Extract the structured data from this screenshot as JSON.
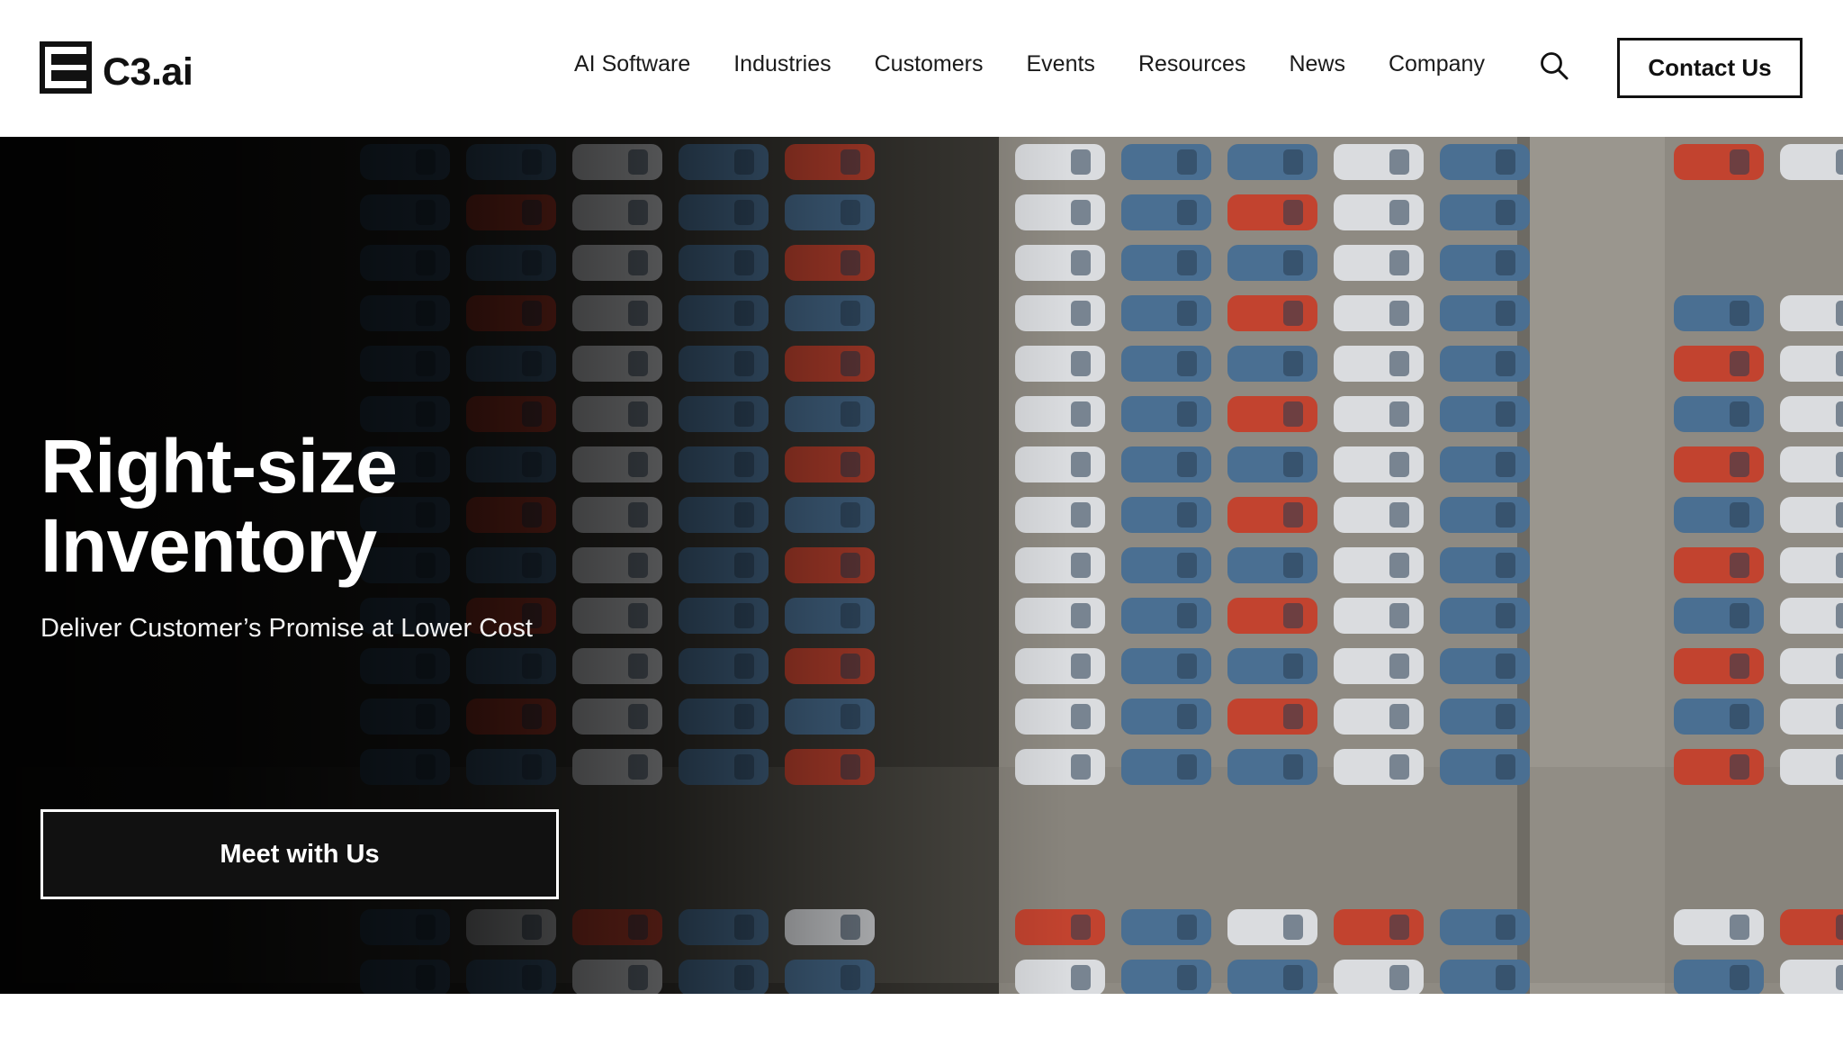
{
  "brand": {
    "logo_text": "C3.ai"
  },
  "nav": {
    "items": [
      {
        "label": "AI Software"
      },
      {
        "label": "Industries"
      },
      {
        "label": "Customers"
      },
      {
        "label": "Events"
      },
      {
        "label": "Resources"
      },
      {
        "label": "News"
      },
      {
        "label": "Company"
      }
    ],
    "search_icon": "search-icon",
    "contact_label": "Contact Us"
  },
  "hero": {
    "title_line1": "Right-size",
    "title_line2": "Inventory",
    "subtitle": "Deliver Customer’s Promise at Lower Cost",
    "cta_label": "Meet with Us",
    "background": "aerial-parking-lot-of-cars"
  },
  "colors": {
    "text_dark": "#111111",
    "hero_text": "#ffffff",
    "button_bg": "#111111",
    "car_blue": "#4a6f92",
    "car_red": "#c2432f",
    "car_white": "#dadcdf"
  }
}
